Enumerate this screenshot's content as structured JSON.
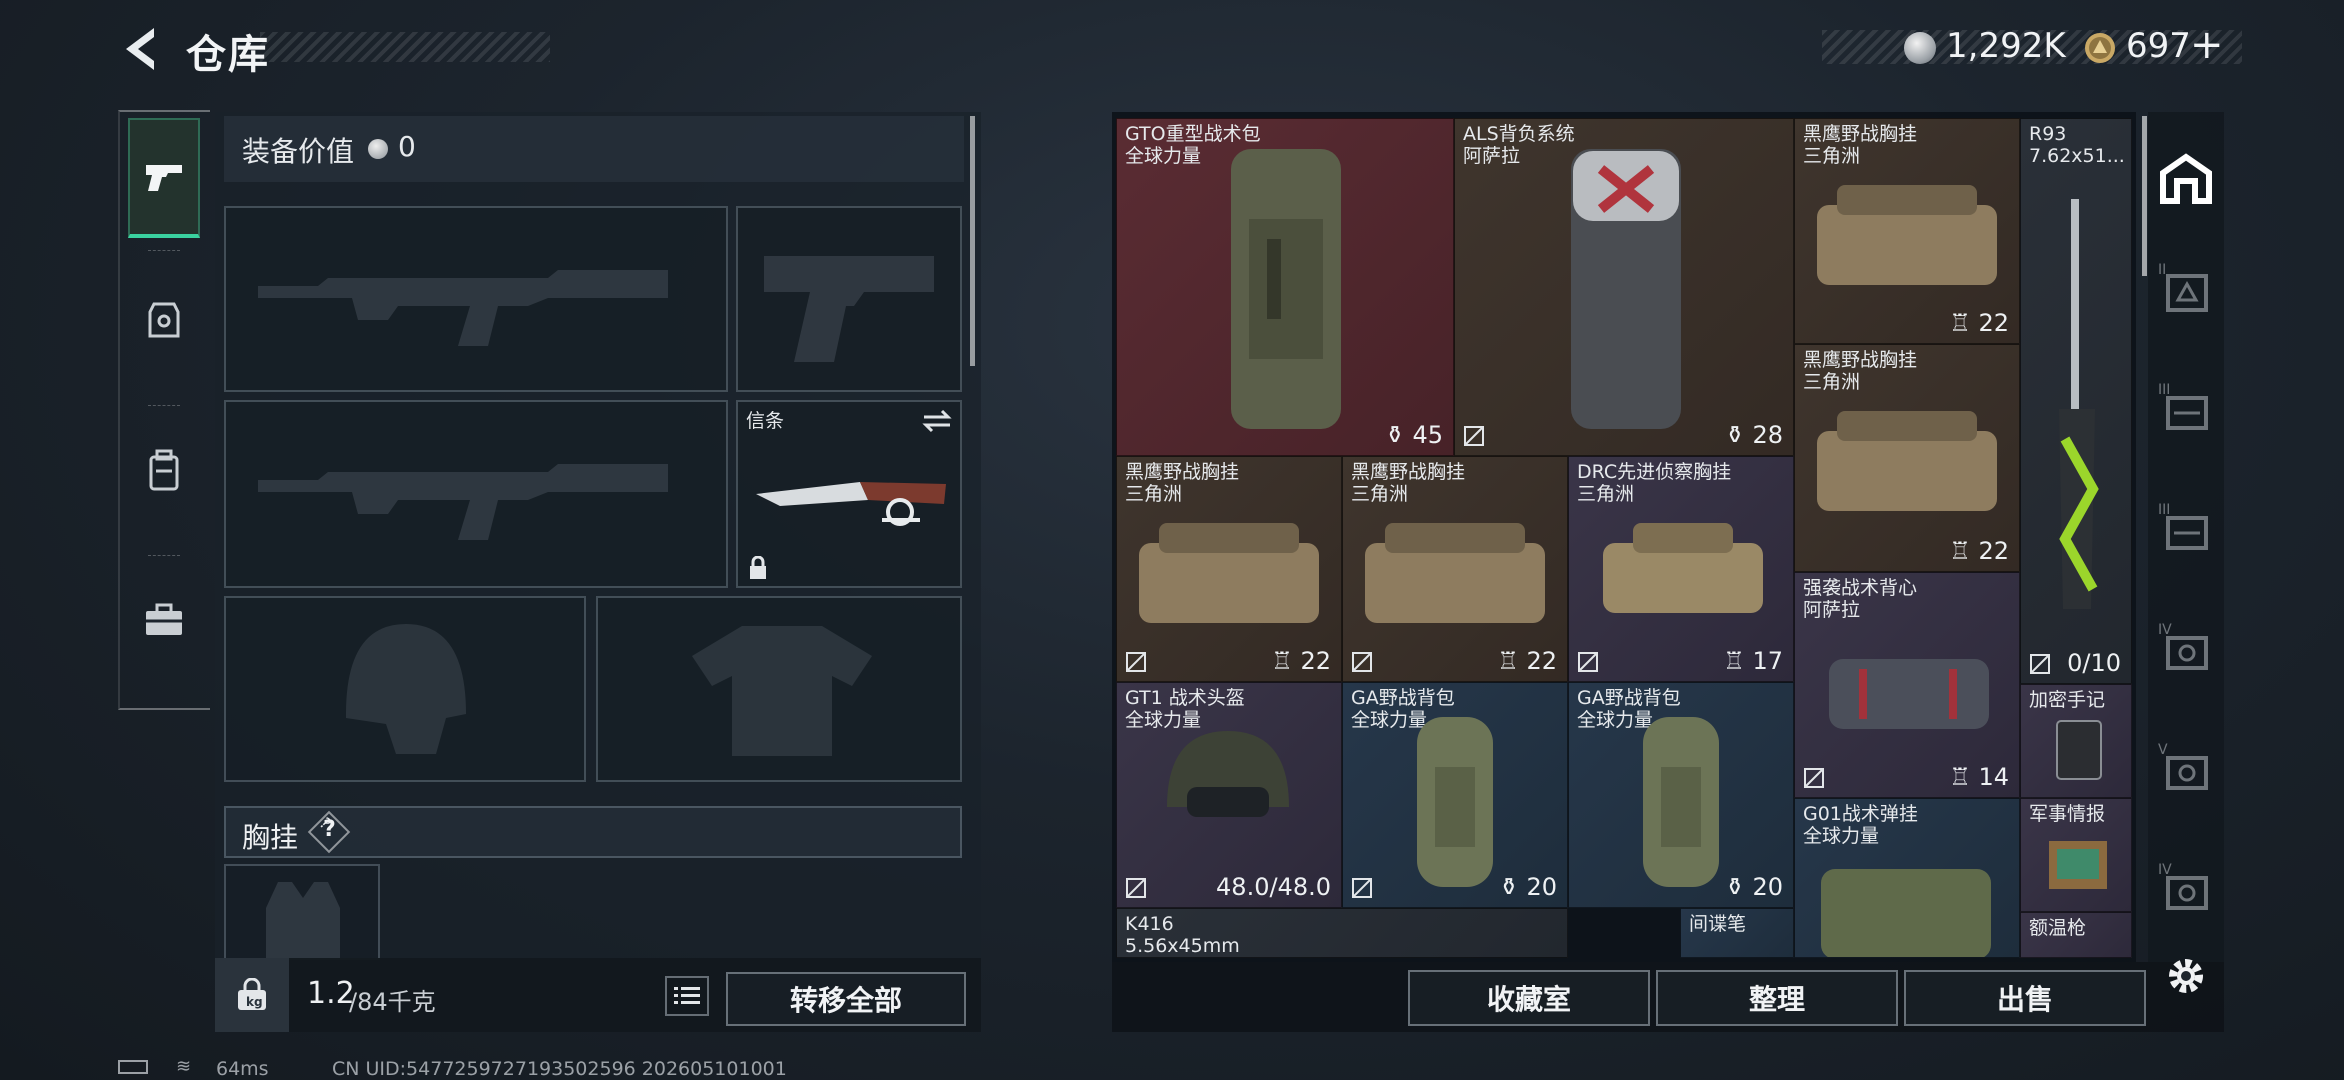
{
  "header": {
    "title": "仓库",
    "currencies": [
      {
        "icon": "silver-coin-icon",
        "value": "1,292K"
      },
      {
        "icon": "gold-coin-icon",
        "value": "697"
      }
    ],
    "add_label": "+"
  },
  "nav": {
    "items": [
      {
        "name": "nav-weapons",
        "icon": "pistol-icon",
        "active": true
      },
      {
        "name": "nav-armor",
        "icon": "vest-icon",
        "active": false
      },
      {
        "name": "nav-backpack",
        "icon": "backpack-icon",
        "active": false
      },
      {
        "name": "nav-case",
        "icon": "briefcase-icon",
        "active": false
      }
    ]
  },
  "loadout": {
    "value_label": "装备价值",
    "value": "0",
    "knife_slot_label": "信条",
    "chest_label": "胸挂",
    "help": "?",
    "weight_value": "1.2",
    "weight_max": "/84千克",
    "transfer_all": "转移全部"
  },
  "items": [
    {
      "name": "GTO重型战术包",
      "sub": "全球力量",
      "count": "45",
      "color": "red"
    },
    {
      "name": "ALS背负系统",
      "sub": "阿萨拉",
      "count": "28",
      "color": "brown"
    },
    {
      "name": "黑鹰野战胸挂",
      "sub": "三角洲",
      "count": "22",
      "color": "brown"
    },
    {
      "name": "R93",
      "sub": "7.62x51...",
      "count": "0/10",
      "color": "dark"
    },
    {
      "name": "黑鹰野战胸挂",
      "sub": "三角洲",
      "count": "22",
      "color": "brown"
    },
    {
      "name": "黑鹰野战胸挂",
      "sub": "三角洲",
      "count": "22",
      "color": "brown"
    },
    {
      "name": "黑鹰野战胸挂",
      "sub": "三角洲",
      "count": "22",
      "color": "brown"
    },
    {
      "name": "DRC先进侦察胸挂",
      "sub": "三角洲",
      "count": "17",
      "color": "purple"
    },
    {
      "name": "强袭战术背心",
      "sub": "阿萨拉",
      "count": "14",
      "color": "purple"
    },
    {
      "name": "GT1 战术头盔",
      "sub": "全球力量",
      "count": "48.0/48.0",
      "color": "purple"
    },
    {
      "name": "GA野战背包",
      "sub": "全球力量",
      "count": "20",
      "color": "blue"
    },
    {
      "name": "GA野战背包",
      "sub": "全球力量",
      "count": "20",
      "color": "blue"
    },
    {
      "name": "加密手记",
      "sub": "",
      "count": "",
      "color": "purple"
    },
    {
      "name": "G01战术弹挂",
      "sub": "全球力量",
      "count": "",
      "color": "blue"
    },
    {
      "name": "军事情报",
      "sub": "",
      "count": "",
      "color": "purple"
    },
    {
      "name": "K416",
      "sub": "5.56x45mm",
      "count": "",
      "color": "dark"
    },
    {
      "name": "间谍笔",
      "sub": "",
      "count": "",
      "color": "blue"
    },
    {
      "name": "额温枪",
      "sub": "",
      "count": "",
      "color": "purple"
    }
  ],
  "right_tabs": [
    "home-tab",
    "tier-2-tab",
    "tier-3-tab",
    "tier-3b-tab",
    "tier-4-tab",
    "tier-5-tab",
    "tier-4b-tab"
  ],
  "tab_labels": {
    "t2": "II",
    "t3": "III",
    "t3b": "III",
    "t4": "IV",
    "t5": "V",
    "t4b": "IV"
  },
  "actions": {
    "collection": "收藏室",
    "organize": "整理",
    "sell": "出售"
  },
  "status": {
    "ping": "64ms",
    "uid": "CN UID:5477259727193502596 202605101001"
  },
  "colors": {
    "accent": "#3ad29f",
    "slot_border": "#96a5b4",
    "red_cell": "#5a2c33"
  }
}
